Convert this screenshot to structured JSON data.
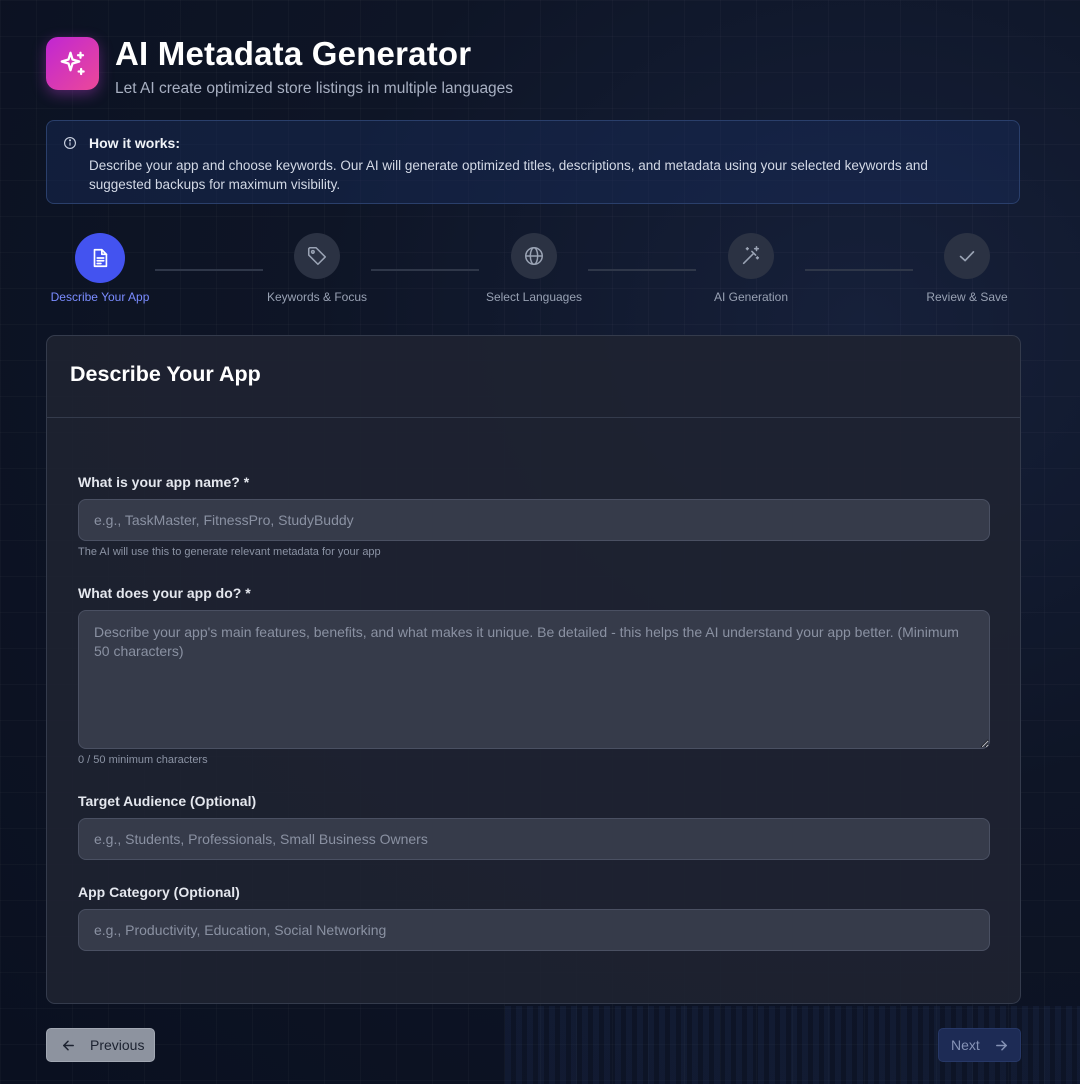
{
  "header": {
    "title": "AI Metadata Generator",
    "subtitle": "Let AI create optimized store listings in multiple languages",
    "icon": "sparkles-icon",
    "accent": "#d946ef"
  },
  "info": {
    "title": "How it works:",
    "text": "Describe your app and choose keywords. Our AI will generate optimized titles, descriptions, and metadata using your selected keywords and suggested backups for maximum visibility."
  },
  "steps": [
    {
      "label": "Describe Your App",
      "icon": "document-icon",
      "active": true
    },
    {
      "label": "Keywords & Focus",
      "icon": "tag-icon",
      "active": false
    },
    {
      "label": "Select Languages",
      "icon": "globe-icon",
      "active": false
    },
    {
      "label": "AI Generation",
      "icon": "magic-wand-icon",
      "active": false
    },
    {
      "label": "Review & Save",
      "icon": "check-icon",
      "active": false
    }
  ],
  "form": {
    "title": "Describe Your App",
    "app_name": {
      "label": "What is your app name? *",
      "placeholder": "e.g., TaskMaster, FitnessPro, StudyBuddy",
      "value": "",
      "hint": "The AI will use this to generate relevant metadata for your app"
    },
    "description": {
      "label": "What does your app do? *",
      "placeholder": "Describe your app's main features, benefits, and what makes it unique. Be detailed - this helps the AI understand your app better. (Minimum 50 characters)",
      "value": "",
      "counter": "0 / 50 minimum characters"
    },
    "audience": {
      "label": "Target Audience (Optional)",
      "placeholder": "e.g., Students, Professionals, Small Business Owners",
      "value": ""
    },
    "category": {
      "label": "App Category (Optional)",
      "placeholder": "e.g., Productivity, Education, Social Networking",
      "value": ""
    }
  },
  "nav": {
    "previous": "Previous",
    "next": "Next"
  }
}
